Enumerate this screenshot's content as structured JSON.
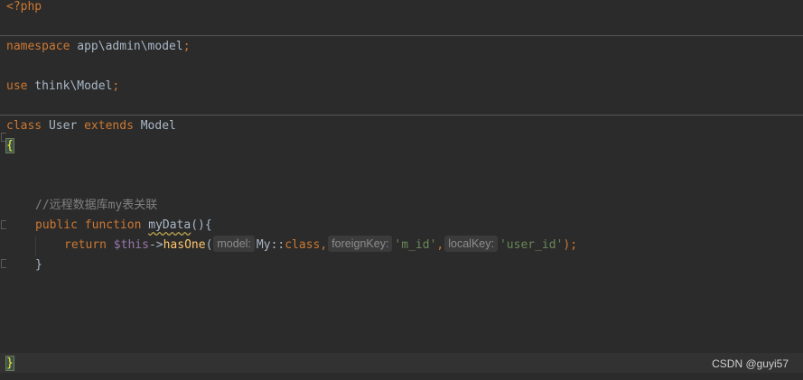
{
  "code": {
    "php_open": "<?php",
    "namespace_kw": "namespace",
    "namespace_path": " app\\admin\\model",
    "use_kw": "use",
    "use_path": " think\\Model",
    "semicolon": ";",
    "class_kw": "class",
    "class_name": " User ",
    "extends_kw": "extends",
    "parent_class": " Model",
    "open_brace": "{",
    "comment": "//远程数据库my表关联",
    "public_kw": "public",
    "function_kw": " function ",
    "method_name": "myData",
    "method_params": "(){",
    "return_kw": "return ",
    "this_var": "$this",
    "arrow": "->",
    "call_name": "hasOne",
    "paren_open": "(",
    "hint_model": "model:",
    "model_value": "My::",
    "class_const": "class",
    "comma": ",",
    "hint_foreign": "foreignKey:",
    "foreign_value": "'m_id'",
    "hint_local": "localKey:",
    "local_value": "'user_id'",
    "paren_close_semicolon": ");",
    "close_method_brace": "}",
    "close_class_brace": "}"
  },
  "watermark": "CSDN @guyi57",
  "colors": {
    "background": "#2b2b2b",
    "keyword": "#cc7832",
    "function": "#ffc66d",
    "variable": "#9876aa",
    "string": "#6a8759",
    "comment": "#808080",
    "text": "#a9b7c6"
  }
}
